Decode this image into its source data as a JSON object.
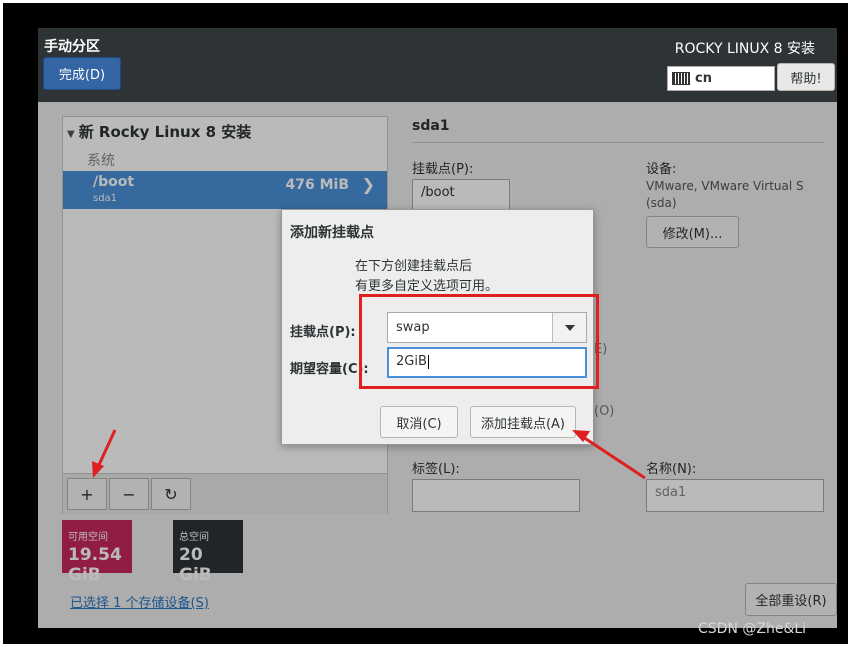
{
  "header": {
    "title": "手动分区",
    "done_label": "完成(D)",
    "product": "ROCKY LINUX 8 安装",
    "keyboard_layout": "cn",
    "help_label": "帮助!"
  },
  "tree": {
    "title": "新 Rocky Linux 8 安装",
    "group": "系统",
    "mountpoint": {
      "name": "/boot",
      "device": "sda1",
      "size": "476 MiB"
    }
  },
  "toolbar": {
    "add": "+",
    "remove": "−",
    "refresh": "↻"
  },
  "space": {
    "available_label": "可用空间",
    "available_value": "19.54 GiB",
    "available_color": "#c8285e",
    "total_label": "总空间",
    "total_value": "20 GiB",
    "total_color": "#2e3436"
  },
  "storage_link": "已选择 1 个存储设备(S)",
  "details": {
    "title": "sda1",
    "mount_label": "挂载点(P):",
    "mount_value": "/boot",
    "device_label": "设备:",
    "device_text_1": "VMware, VMware Virtual S",
    "device_text_2": "(sda)",
    "modify_label": "修改(M)...",
    "partial_1": "E)",
    "partial_2": "(O)",
    "tag_label": "标签(L):",
    "name_label": "名称(N):",
    "name_value": "sda1",
    "reset_label": "全部重设(R)"
  },
  "dialog": {
    "title": "添加新挂载点",
    "desc_line1": "在下方创建挂载点后",
    "desc_line2": "有更多自定义选项可用。",
    "mount_label": "挂载点(P):",
    "mount_value": "swap",
    "capacity_label": "期望容量(C):",
    "capacity_value": "2GiB",
    "cancel_label": "取消(C)",
    "add_label": "添加挂载点(A)"
  },
  "watermark": "CSDN @Zhe&Li",
  "colors": {
    "accent": "#4a90d9",
    "annotation": "#e02020"
  }
}
